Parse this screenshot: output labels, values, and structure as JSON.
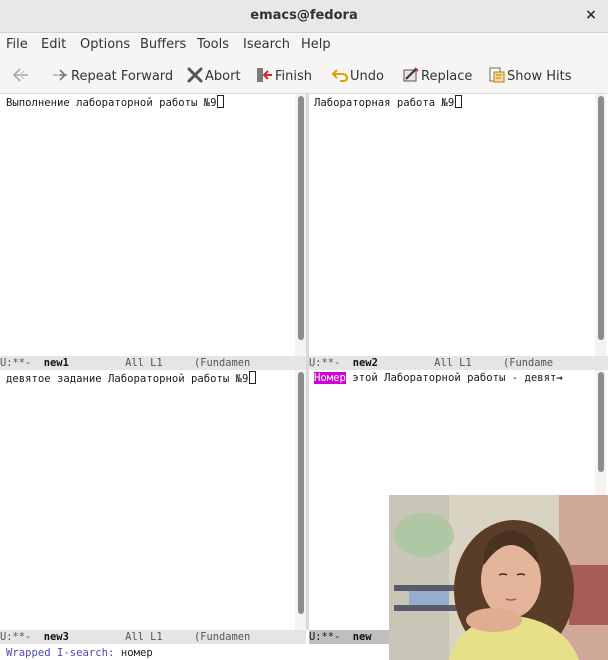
{
  "window": {
    "title": "emacs@fedora",
    "close_glyph": "×"
  },
  "menu": [
    "File",
    "Edit",
    "Options",
    "Buffers",
    "Tools",
    "Isearch",
    "Help"
  ],
  "toolbar": {
    "back_icon": "back-arrow-icon",
    "repeat_forward": "Repeat Forward",
    "abort": "Abort",
    "finish": "Finish",
    "undo": "Undo",
    "replace": "Replace",
    "show_hits": "Show Hits"
  },
  "panes": {
    "top_left": {
      "line": "Выполнение лабораторной работы №9"
    },
    "top_right": {
      "line": "Лабораторная работа №9"
    },
    "bottom_left": {
      "line": "девятое задание Лабораторной работы №9"
    },
    "bottom_right": {
      "match": "Номер",
      "rest": " этой Лабораторной работы - девят",
      "continuation": "→"
    }
  },
  "modelines": {
    "top_left": {
      "status": "U:**-  ",
      "buffer": "new1",
      "pos": "         All L1     (Fundamen"
    },
    "top_right": {
      "status": "U:**-  ",
      "buffer": "new2",
      "pos": "         All L1     (Fundame"
    },
    "bottom_left": {
      "status": "U:**-  ",
      "buffer": "new3",
      "pos": "         All L1     (Fundamen"
    },
    "bottom_right": {
      "status": "U:**-  ",
      "buffer": "new"
    }
  },
  "echo": {
    "prompt": "Wrapped I-search:",
    "query": " номер"
  },
  "colors": {
    "match_highlight": "#d000d8",
    "prompt": "#4d4db8",
    "modeline_active": "#bfbfbf",
    "modeline_inactive": "#e5e5e5"
  }
}
